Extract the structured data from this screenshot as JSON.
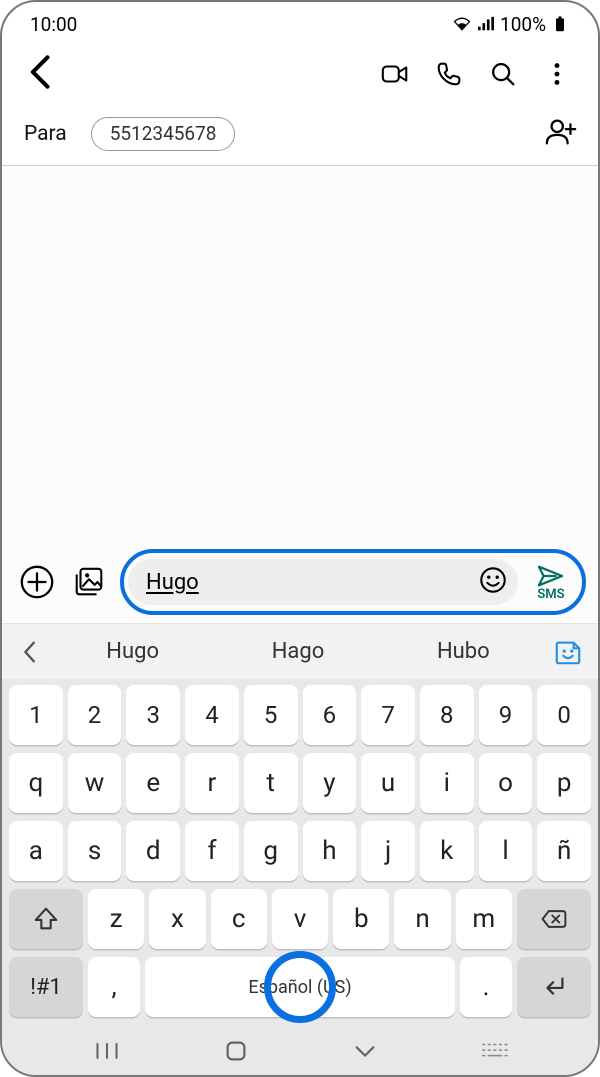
{
  "status": {
    "time": "10:00",
    "battery": "100%"
  },
  "header": {},
  "recipients": {
    "label": "Para",
    "chip": "5512345678"
  },
  "compose": {
    "text": "Hugo",
    "send_label": "SMS"
  },
  "suggestions": {
    "s1": "Hugo",
    "s2": "Hago",
    "s3": "Hubo"
  },
  "keyboard": {
    "row1": {
      "k0": "1",
      "k1": "2",
      "k2": "3",
      "k3": "4",
      "k4": "5",
      "k5": "6",
      "k6": "7",
      "k7": "8",
      "k8": "9",
      "k9": "0"
    },
    "row2": {
      "k0": "q",
      "k1": "w",
      "k2": "e",
      "k3": "r",
      "k4": "t",
      "k5": "y",
      "k6": "u",
      "k7": "i",
      "k8": "o",
      "k9": "p"
    },
    "row3": {
      "k0": "a",
      "k1": "s",
      "k2": "d",
      "k3": "f",
      "k4": "g",
      "k5": "h",
      "k6": "j",
      "k7": "k",
      "k8": "l",
      "k9": "ñ"
    },
    "row4": {
      "k0": "z",
      "k1": "x",
      "k2": "c",
      "k3": "v",
      "k4": "b",
      "k5": "n",
      "k6": "m"
    },
    "row5": {
      "sym": "!#1",
      "comma": ",",
      "space": "Español (US)",
      "dot": "."
    }
  }
}
